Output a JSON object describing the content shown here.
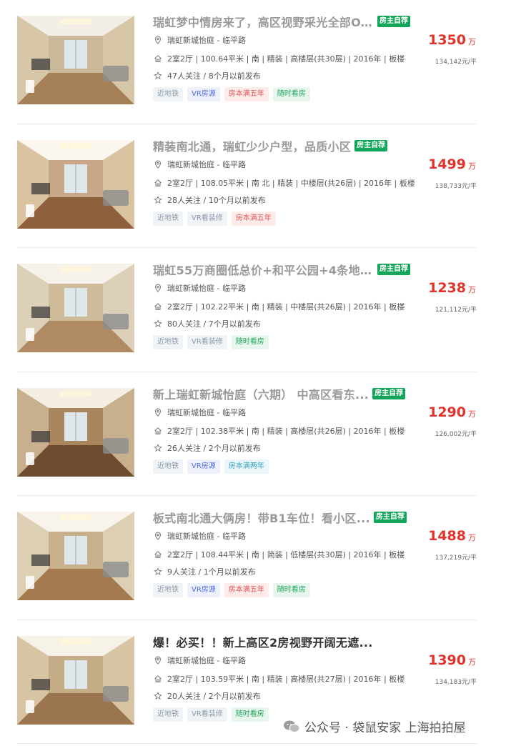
{
  "listings": [
    {
      "title": "瑞虹梦中情房来了，高区视野采光全部O...",
      "owner_badge": "房主自荐",
      "location": "瑞虹新城怡庭 - 临平路",
      "house_info": "2室2厅 | 100.64平米 | 南 | 精装 | 高楼层(共30层) | 2016年 | 板楼",
      "follow_info": "47人关注 / 8个月以前发布",
      "tags": [
        {
          "label": "近地铁",
          "kind": "metro"
        },
        {
          "label": "VR房源",
          "kind": "vr"
        },
        {
          "label": "房本满五年",
          "kind": "tax5"
        },
        {
          "label": "随时看房",
          "kind": "anytime"
        }
      ],
      "price": "1350",
      "price_unit": "万",
      "unit_price": "134,142元/平"
    },
    {
      "title": "精装南北通，瑞虹少少户型，品质小区",
      "owner_badge": "房主自荐",
      "location": "瑞虹新城怡庭 - 临平路",
      "house_info": "2室2厅 | 108.05平米 | 南 北 | 精装 | 中楼层(共26层) | 2016年 | 板楼",
      "follow_info": "28人关注 / 10个月以前发布",
      "tags": [
        {
          "label": "近地铁",
          "kind": "metro"
        },
        {
          "label": "VR看装修",
          "kind": "vrseen"
        },
        {
          "label": "房本满五年",
          "kind": "tax5"
        }
      ],
      "price": "1499",
      "price_unit": "万",
      "unit_price": "138,733元/平"
    },
    {
      "title": "瑞虹55万商圈低总价+和平公园+4条地...",
      "owner_badge": "房主自荐",
      "location": "瑞虹新城怡庭 - 临平路",
      "house_info": "2室2厅 | 102.22平米 | 南 | 精装 | 中楼层(共26层) | 2016年 | 板楼",
      "follow_info": "80人关注 / 7个月以前发布",
      "tags": [
        {
          "label": "近地铁",
          "kind": "metro"
        },
        {
          "label": "VR看装修",
          "kind": "vrseen"
        },
        {
          "label": "随时看房",
          "kind": "anytime"
        }
      ],
      "price": "1238",
      "price_unit": "万",
      "unit_price": "121,112元/平"
    },
    {
      "title": "新上瑞虹新城怡庭（六期） 中高区看东...",
      "owner_badge": "房主自荐",
      "location": "瑞虹新城怡庭 - 临平路",
      "house_info": "2室2厅 | 102.38平米 | 南 | 精装 | 高楼层(共26层) | 2016年 | 板楼",
      "follow_info": "26人关注 / 2个月以前发布",
      "tags": [
        {
          "label": "近地铁",
          "kind": "metro"
        },
        {
          "label": "VR房源",
          "kind": "vr"
        },
        {
          "label": "房本满两年",
          "kind": "tax2"
        }
      ],
      "price": "1290",
      "price_unit": "万",
      "unit_price": "126,002元/平"
    },
    {
      "title": "板式南北通大俩房！带B1车位！看小区...",
      "owner_badge": "房主自荐",
      "location": "瑞虹新城怡庭 - 临平路",
      "house_info": "2室2厅 | 108.44平米 | 南 | 简装 | 低楼层(共30层) | 2016年 | 板楼",
      "follow_info": "9人关注 / 1个月以前发布",
      "tags": [
        {
          "label": "近地铁",
          "kind": "metro"
        },
        {
          "label": "VR房源",
          "kind": "vr"
        },
        {
          "label": "房本满五年",
          "kind": "tax5"
        },
        {
          "label": "随时看房",
          "kind": "anytime"
        }
      ],
      "price": "1488",
      "price_unit": "万",
      "unit_price": "137,219元/平"
    },
    {
      "title": "爆！必买！！新上高区2房视野开阔无遮...",
      "owner_badge": "",
      "location": "瑞虹新城怡庭 - 临平路",
      "house_info": "2室2厅 | 103.59平米 | 南 | 精装 | 高楼层(共27层) | 2016年 | 板楼",
      "follow_info": "20人关注 / 2个月以前发布",
      "tags": [
        {
          "label": "近地铁",
          "kind": "metro"
        },
        {
          "label": "VR看装修",
          "kind": "vrseen"
        },
        {
          "label": "随时看房",
          "kind": "anytime"
        }
      ],
      "price": "1390",
      "price_unit": "万",
      "unit_price": "134,183元/平"
    }
  ],
  "watermark": {
    "text": "公众号 · 袋鼠安家 上海拍拍屋",
    "icon": "wechat-icon"
  },
  "colors": {
    "price": "#e1332b",
    "owner_badge": "#13a65a"
  }
}
